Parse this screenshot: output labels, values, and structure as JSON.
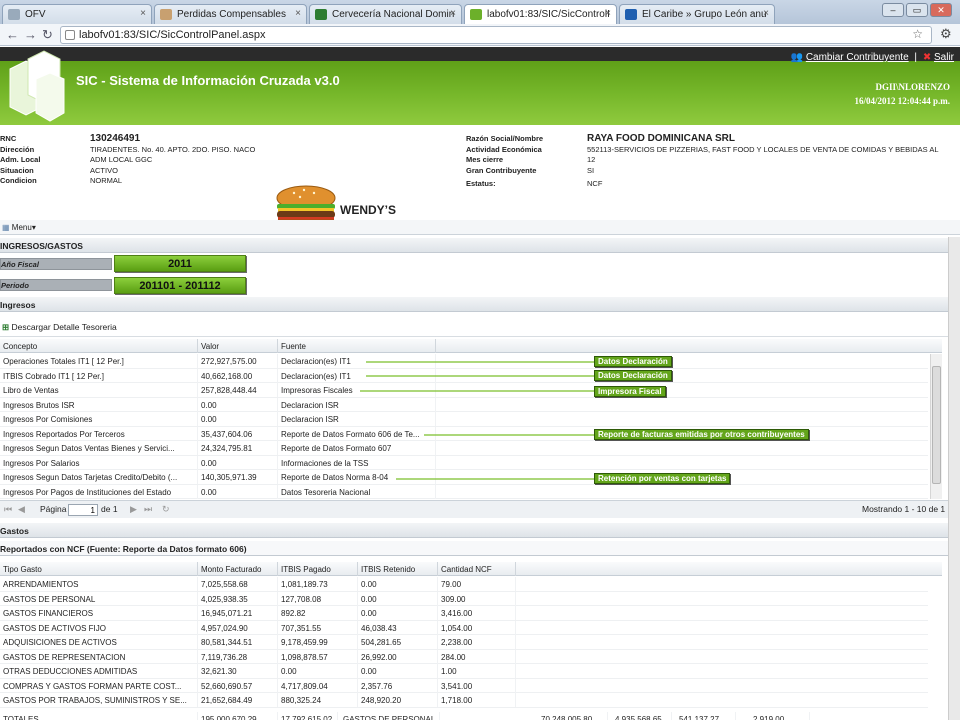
{
  "browser": {
    "tabs": [
      "OFV",
      "Perdidas Compensables",
      "Cervecería Nacional Domin",
      "labofv01:83/SIC/SicControlI",
      "El Caribe » Grupo León anu"
    ],
    "url": "labofv01:83/SIC/SicControlPanel.aspx"
  },
  "app": {
    "title": "SIC - Sistema de Información Cruzada v3.0",
    "cambiar": "Cambiar Contribuyente",
    "salir": "Salir",
    "user": "DGII\\NLORENZO",
    "datetime": "16/04/2012 12:04:44 p.m."
  },
  "info": {
    "left": [
      {
        "label": "RNC",
        "value": "130246491"
      },
      {
        "label": "Dirección",
        "value": "TIRADENTES. No. 40. APTO. 2DO. PISO. NACO"
      },
      {
        "label": "Adm. Local",
        "value": "ADM LOCAL GGC"
      },
      {
        "label": "Situacion",
        "value": "ACTIVO"
      },
      {
        "label": "Condicion",
        "value": "NORMAL"
      }
    ],
    "right": [
      {
        "label": "Razón Social/Nombre",
        "value": "RAYA FOOD DOMINICANA SRL"
      },
      {
        "label": "Actividad Económica",
        "value": "552113-SERVICIOS DE PIZZERIAS, FAST FOOD Y LOCALES DE VENTA DE COMIDAS Y BEBIDAS AL"
      },
      {
        "label": "Mes cierre",
        "value": "12"
      },
      {
        "label": "Gran Contribuyente",
        "value": "SI"
      },
      {
        "label": "Estatus:",
        "value": "NCF"
      }
    ]
  },
  "brand": "WENDY’S",
  "menu": "Menu",
  "sections": {
    "ingresos_gastos": "INGRESOS/GASTOS",
    "anio_label": "Año Fiscal",
    "anio_value": "2011",
    "periodo_label": "Periodo",
    "periodo_value": "201101 - 201112",
    "ingresos": "Ingresos",
    "descargar": "Descargar Detalle Tesoreria",
    "gastos": "Gastos",
    "gastos_sub": "Reportados con NCF (Fuente: Reporte da Datos formato 606)"
  },
  "ingresos_table": {
    "headers": [
      "Concepto",
      "Valor",
      "Fuente"
    ],
    "rows": [
      [
        "Operaciones Totales IT1 [ 12 Per.]",
        "272,927,575.00",
        "Declaracion(es) IT1"
      ],
      [
        "ITBIS Cobrado IT1 [ 12 Per.]",
        "40,662,168.00",
        "Declaracion(es) IT1"
      ],
      [
        "Libro de Ventas",
        "257,828,448.44",
        "Impresoras Fiscales"
      ],
      [
        "Ingresos Brutos ISR",
        "0.00",
        "Declaracion ISR"
      ],
      [
        "Ingresos Por Comisiones",
        "0.00",
        "Declaracion ISR"
      ],
      [
        "Ingresos Reportados Por Terceros",
        "35,437,604.06",
        "Reporte de Datos Formato 606 de Te..."
      ],
      [
        "Ingresos Segun Datos Ventas Bienes y Servici...",
        "24,324,795.81",
        "Reporte de Datos Formato 607"
      ],
      [
        "Ingresos Por Salarios",
        "0.00",
        "Informaciones de la TSS"
      ],
      [
        "Ingresos Segun Datos Tarjetas Credito/Debito (...",
        "140,305,971.39",
        "Reporte de Datos Norma 8-04"
      ],
      [
        "Ingresos Por Pagos de Instituciones del Estado",
        "0.00",
        "Datos Tesoreria Nacional"
      ]
    ]
  },
  "pager": {
    "pagina": "Página",
    "page": "1",
    "de": "de 1",
    "mostrando": "Mostrando 1 - 10 de 1"
  },
  "callouts": [
    "Datos Declaración",
    "Datos Declaración",
    "Impresora Fiscal",
    "Reporte de facturas emitidas por otros contribuyentes",
    "Retención por ventas con tarjetas"
  ],
  "gastos_table": {
    "headers": [
      "Tipo Gasto",
      "Monto Facturado",
      "ITBIS Pagado",
      "ITBIS Retenido",
      "Cantidad NCF"
    ],
    "rows": [
      [
        "ARRENDAMIENTOS",
        "7,025,558.68",
        "1,081,189.73",
        "0.00",
        "79.00"
      ],
      [
        "GASTOS DE PERSONAL",
        "4,025,938.35",
        "127,708.08",
        "0.00",
        "309.00"
      ],
      [
        "GASTOS FINANCIEROS",
        "16,945,071.21",
        "892.82",
        "0.00",
        "3,416.00"
      ],
      [
        "GASTOS DE ACTIVOS FIJO",
        "4,957,024.90",
        "707,351.55",
        "46,038.43",
        "1,054.00"
      ],
      [
        "ADQUISICIONES DE ACTIVOS",
        "80,581,344.51",
        "9,178,459.99",
        "504,281.65",
        "2,238.00"
      ],
      [
        "GASTOS DE REPRESENTACION",
        "7,119,736.28",
        "1,098,878.57",
        "26,992.00",
        "284.00"
      ],
      [
        "OTRAS DEDUCCIONES ADMITIDAS",
        "32,621.30",
        "0.00",
        "0.00",
        "1.00"
      ],
      [
        "COMPRAS Y GASTOS FORMAN PARTE COST...",
        "52,660,690.57",
        "4,717,809.04",
        "2,357.76",
        "3,541.00"
      ],
      [
        "GASTOS POR TRABAJOS, SUMINISTROS Y SE...",
        "21,652,684.49",
        "880,325.24",
        "248,920.20",
        "1,718.00"
      ]
    ],
    "partial": [
      "TOTALES",
      "195,000,670.29",
      "17,792,615.02",
      "GASTOS DE PERSONAL",
      "70,248,005.80",
      "4,935,568.65",
      "541,137.27",
      "2,919.00"
    ]
  }
}
